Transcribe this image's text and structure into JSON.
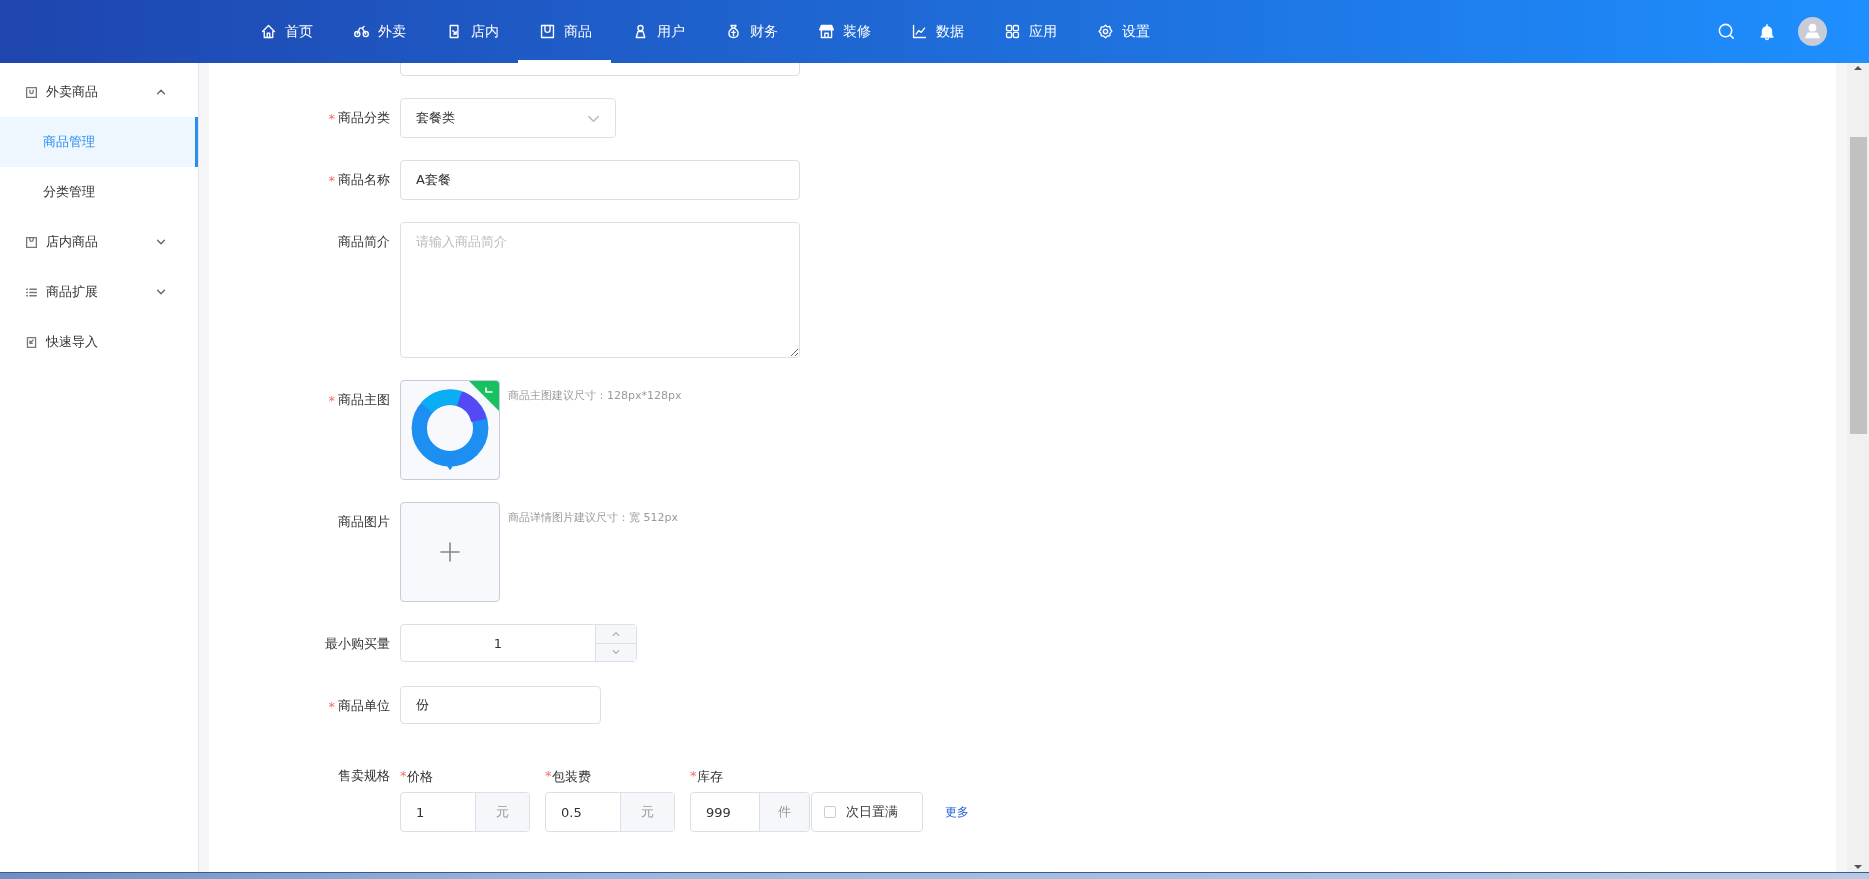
{
  "nav": {
    "items": [
      {
        "label": "首页",
        "selected": false
      },
      {
        "label": "外卖",
        "selected": false
      },
      {
        "label": "店内",
        "selected": false
      },
      {
        "label": "商品",
        "selected": true
      },
      {
        "label": "用户",
        "selected": false
      },
      {
        "label": "财务",
        "selected": false
      },
      {
        "label": "装修",
        "selected": false
      },
      {
        "label": "数据",
        "selected": false
      },
      {
        "label": "应用",
        "selected": false
      },
      {
        "label": "设置",
        "selected": false
      }
    ]
  },
  "sidebar": {
    "items": [
      {
        "label": "外卖商品",
        "expanded": true,
        "children": [
          {
            "label": "商品管理",
            "selected": true
          },
          {
            "label": "分类管理",
            "selected": false
          }
        ]
      },
      {
        "label": "店内商品",
        "expanded": false
      },
      {
        "label": "商品扩展",
        "expanded": false
      },
      {
        "label": "快速导入"
      }
    ]
  },
  "form": {
    "fields": [
      {
        "kind": "clipped"
      },
      {
        "kind": "select",
        "label": "商品分类",
        "required_mark": "*",
        "value": "套餐类"
      },
      {
        "kind": "input",
        "label": "商品名称",
        "required_mark": "*",
        "value": "A套餐"
      },
      {
        "kind": "textarea",
        "label": "商品简介",
        "placeholder": "请输入商品简介"
      },
      {
        "kind": "image",
        "label": "商品主图",
        "required_mark": "*",
        "hint": "商品主图建议尺寸：128px*128px",
        "uploaded": true
      },
      {
        "kind": "image",
        "label": "商品图片",
        "hint": "商品详情图片建议尺寸：宽 512px",
        "uploaded": false
      },
      {
        "kind": "number",
        "label": "最小购买量",
        "value": "1"
      },
      {
        "kind": "short",
        "label": "商品单位",
        "required_mark": "*",
        "value": "份"
      },
      {
        "kind": "spec",
        "label": "售卖规格",
        "columns": [
          {
            "label": "价格",
            "required_mark": "*",
            "value": "1",
            "unit": "元"
          },
          {
            "label": "包装费",
            "required_mark": "*",
            "value": "0.5",
            "unit": "元"
          },
          {
            "label": "库存",
            "required_mark": "*",
            "value": "999",
            "unit": "件"
          }
        ],
        "checkbox": {
          "label": "次日置满",
          "checked": false
        },
        "link": "更多"
      }
    ]
  }
}
